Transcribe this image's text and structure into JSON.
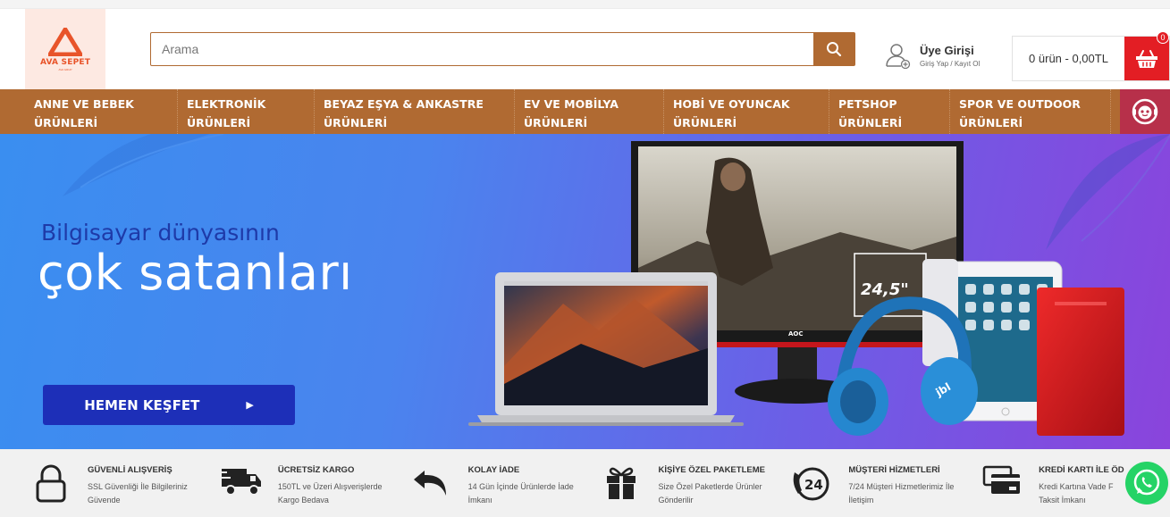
{
  "header": {
    "logo_text": "AVA SEPET",
    "logo_sub": "AVA GRUP",
    "search_placeholder": "Arama",
    "account_title": "Üye Girişi",
    "account_sub": "Giriş Yap / Kayıt Ol",
    "cart_text": "0 ürün - 0,00TL",
    "cart_badge": "0"
  },
  "nav": {
    "items": [
      {
        "line1": "ANNE VE BEBEK",
        "line2": "ÜRÜNLERİ"
      },
      {
        "line1": "ELEKTRONİK",
        "line2": "ÜRÜNLERİ"
      },
      {
        "line1": "BEYAZ EŞYA & ANKASTRE",
        "line2": "ÜRÜNLERİ"
      },
      {
        "line1": "EV VE MOBİLYA",
        "line2": "ÜRÜNLERİ"
      },
      {
        "line1": "HOBİ VE OYUNCAK",
        "line2": "ÜRÜNLERİ"
      },
      {
        "line1": "PETSHOP",
        "line2": "ÜRÜNLERİ"
      },
      {
        "line1": "SPOR VE OUTDOOR",
        "line2": "ÜRÜNLERİ"
      }
    ]
  },
  "hero": {
    "subtitle": "Bilgisayar dünyasının",
    "title": "çok satanları",
    "cta": "HEMEN KEŞFET",
    "monitor_size": "24,5\"",
    "monitor_brand": "AOC"
  },
  "features": [
    {
      "title": "GÜVENLİ ALIŞVERİŞ",
      "line1": "SSL Güvenliği İle Bilgileriniz",
      "line2": "Güvende",
      "icon": "lock-icon"
    },
    {
      "title": "ÜCRETSİZ KARGO",
      "line1": "150TL ve Üzeri Alışverişlerde",
      "line2": "Kargo Bedava",
      "icon": "truck-icon"
    },
    {
      "title": "KOLAY İADE",
      "line1": "14 Gün İçinde Ürünlerde İade",
      "line2": "İmkanı",
      "icon": "return-arrow-icon"
    },
    {
      "title": "KİŞİYE ÖZEL PAKETLEME",
      "line1": "Size Özel Paketlerde Ürünler",
      "line2": "Gönderilir",
      "icon": "gift-icon"
    },
    {
      "title": "MÜŞTERİ HİZMETLERİ",
      "line1": "7/24 Müşteri Hizmetlerimiz İle",
      "line2": "İletişim",
      "icon": "24-support-icon"
    },
    {
      "title": "KREDİ KARTI İLE ÖD",
      "line1": "Kredi Kartına Vade F",
      "line2": "Taksit İmkanı",
      "icon": "credit-card-icon"
    }
  ],
  "colors": {
    "brand": "#b06a32",
    "cart_red": "#e31e24",
    "cta_blue": "#1d2fb8",
    "help_button": "#b7304a",
    "whatsapp": "#25d366"
  }
}
